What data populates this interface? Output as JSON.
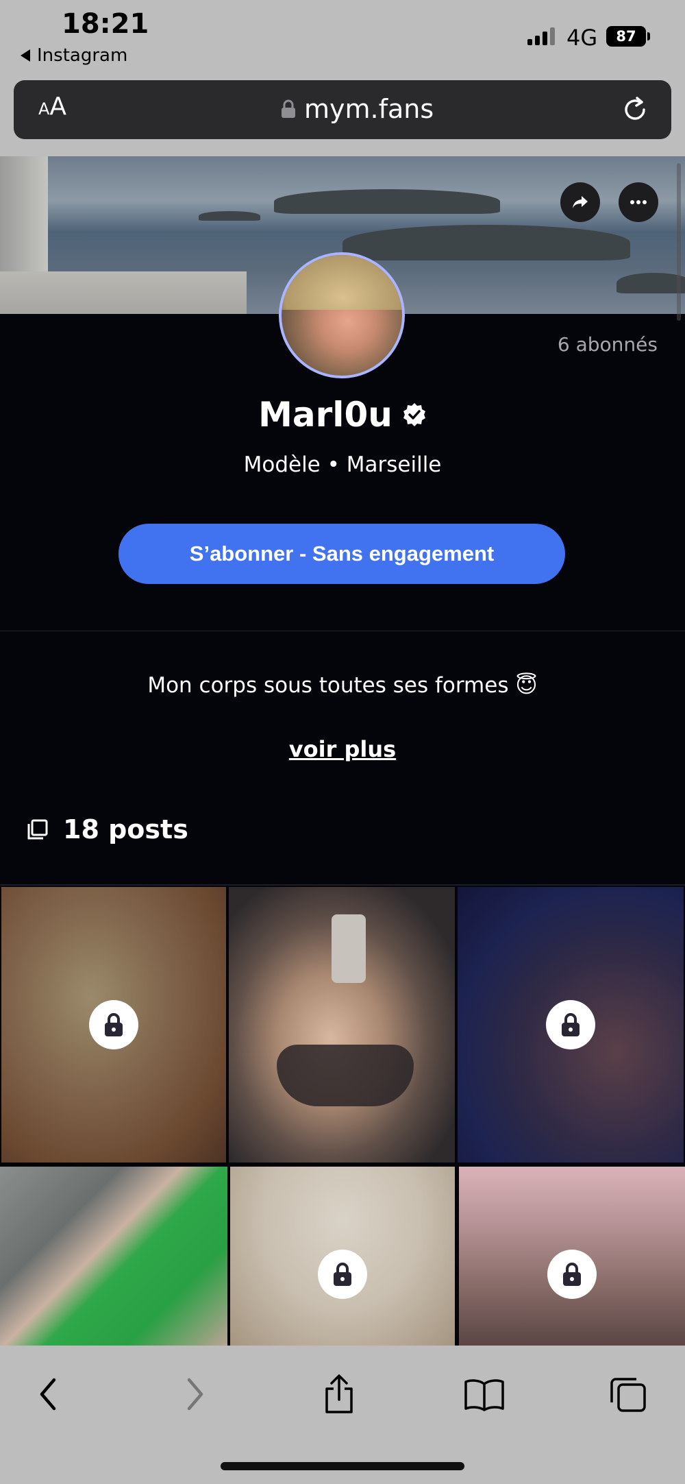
{
  "status_bar": {
    "time": "18:21",
    "back_app": "Instagram",
    "network": "4G",
    "battery": "87"
  },
  "browser": {
    "text_size_label": "AA",
    "url": "mym.fans"
  },
  "profile": {
    "followers": "6 abonnés",
    "name": "Marl0u",
    "subtitle": "Modèle • Marseille",
    "subscribe_label": "S’abonner - Sans engagement",
    "bio": "Mon corps sous toutes ses formes 😇",
    "see_more": "voir plus",
    "posts_count": "18 posts"
  },
  "posts": [
    {
      "locked": true
    },
    {
      "locked": false
    },
    {
      "locked": true
    },
    {
      "locked": false
    },
    {
      "locked": true
    },
    {
      "locked": true
    }
  ],
  "colors": {
    "accent": "#4173f0",
    "background": "#04040b",
    "chrome": "#bdbdbd"
  },
  "icons": [
    "share-icon",
    "more-icon",
    "verified-icon",
    "lock-icon",
    "posts-icon",
    "back-icon",
    "forward-icon",
    "share-sheet-icon",
    "bookmarks-icon",
    "tabs-icon",
    "reload-icon"
  ]
}
